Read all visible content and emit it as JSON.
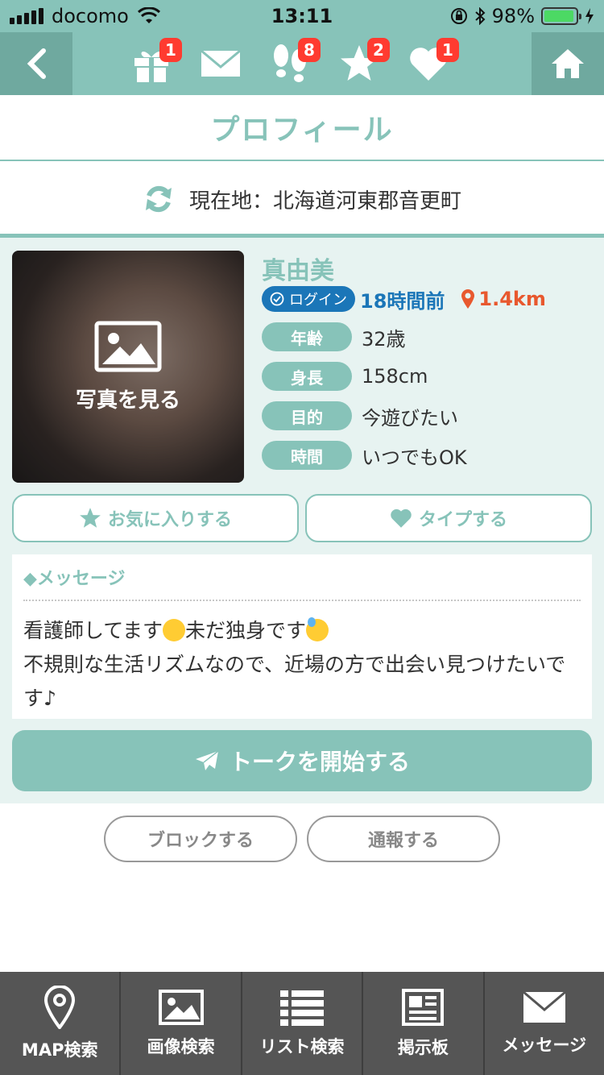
{
  "status_bar": {
    "carrier": "docomo",
    "time": "13:11",
    "battery": "98%",
    "battery_level": 0.98
  },
  "nav": {
    "icons": [
      {
        "name": "gift-icon",
        "badge": "1"
      },
      {
        "name": "mail-icon",
        "badge": ""
      },
      {
        "name": "footprints-icon",
        "badge": "8"
      },
      {
        "name": "star-icon",
        "badge": "2"
      },
      {
        "name": "heart-icon",
        "badge": "1"
      }
    ]
  },
  "header": {
    "title": "プロフィール"
  },
  "location": {
    "text": "現在地：北海道河東郡音更町"
  },
  "profile": {
    "photo_label": "写真を見る",
    "name": "真由美",
    "login_label": "ログイン",
    "last_login": "18時間前",
    "distance": "1.4km",
    "attributes": [
      {
        "label": "年齢",
        "value": "32歳"
      },
      {
        "label": "身長",
        "value": "158cm"
      },
      {
        "label": "目的",
        "value": "今遊びたい"
      },
      {
        "label": "時間",
        "value": "いつでもOK"
      }
    ]
  },
  "actions": {
    "favorite": "お気に入りする",
    "type": "タイプする"
  },
  "message": {
    "heading": "◆メッセージ",
    "line1_a": "看護師してます",
    "line1_b": "未だ独身です",
    "line2": "不規則な生活リズムなので、近場の方で出会い見つけたいです♪"
  },
  "talk_button": "トークを開始する",
  "sub_actions": {
    "block": "ブロックする",
    "report": "通報する"
  },
  "tabbar": {
    "items": [
      {
        "label": "MAP検索",
        "icon": "map-pin-icon"
      },
      {
        "label": "画像検索",
        "icon": "image-icon"
      },
      {
        "label": "リスト検索",
        "icon": "list-icon"
      },
      {
        "label": "掲示板",
        "icon": "newspaper-icon"
      },
      {
        "label": "メッセージ",
        "icon": "mail-icon"
      }
    ]
  },
  "colors": {
    "accent": "#87c3b9",
    "accent_dark": "#6fa99f",
    "login_blue": "#1b76b8",
    "distance_red": "#e8582e",
    "badge_red": "#ff3b30",
    "tabbar_bg": "#555555"
  }
}
